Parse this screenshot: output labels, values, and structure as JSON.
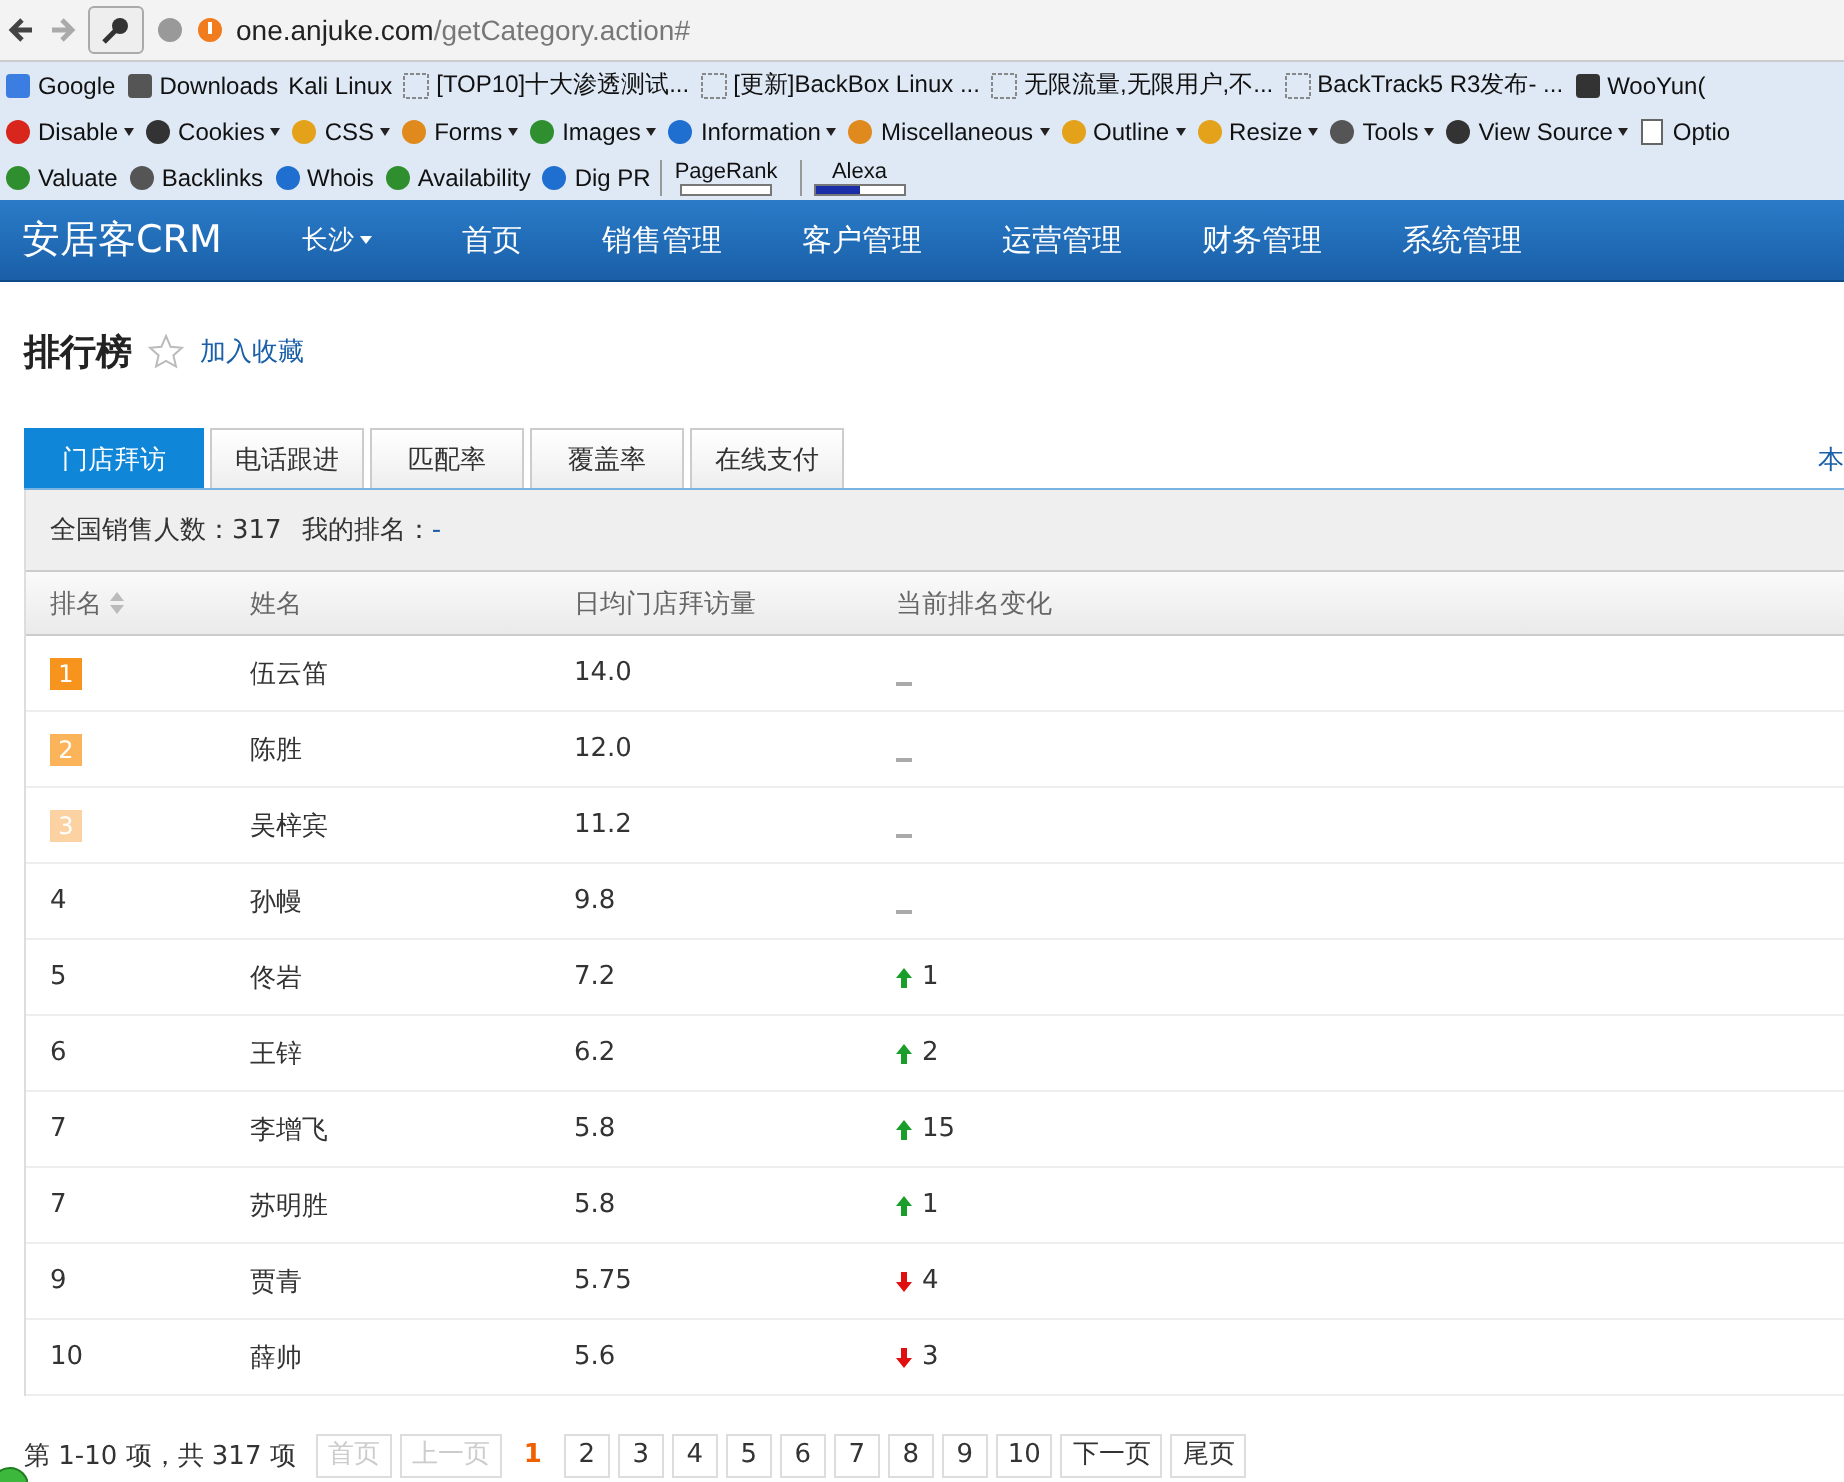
{
  "browser": {
    "url_host": "one.anjuke.com",
    "url_path": "/getCategory.action#",
    "bookmarks": [
      "Google",
      "Downloads",
      "Kali Linux",
      "[TOP10]十大渗透测试...",
      "[更新]BackBox Linux ...",
      "无限流量,无限用户,不...",
      "BackTrack5 R3发布- ...",
      "WooYun("
    ],
    "toolbar": [
      "Disable",
      "Cookies",
      "CSS",
      "Forms",
      "Images",
      "Information",
      "Miscellaneous",
      "Outline",
      "Resize",
      "Tools",
      "View Source",
      "Optio"
    ],
    "seo_tools": [
      {
        "label": "Valuate",
        "kind": "link"
      },
      {
        "label": "Backlinks",
        "kind": "link"
      },
      {
        "label": "Whois",
        "kind": "link"
      },
      {
        "label": "Availability",
        "kind": "link"
      },
      {
        "label": "Dig PR",
        "kind": "link"
      },
      {
        "label": "PageRank",
        "kind": "meter",
        "level": 0
      },
      {
        "label": "Alexa",
        "kind": "meter",
        "level": 0.5
      }
    ]
  },
  "nav": {
    "logo": "安居客CRM",
    "city": "长沙",
    "items": [
      "首页",
      "销售管理",
      "客户管理",
      "运营管理",
      "财务管理",
      "系统管理"
    ]
  },
  "page": {
    "title": "排行榜",
    "favorite": "加入收藏",
    "side_text": "本"
  },
  "tabs": [
    {
      "label": "门店拜访",
      "selected": true
    },
    {
      "label": "电话跟进",
      "selected": false
    },
    {
      "label": "匹配率",
      "selected": false
    },
    {
      "label": "覆盖率",
      "selected": false
    },
    {
      "label": "在线支付",
      "selected": false
    }
  ],
  "summary": {
    "total_label": "全国销售人数：",
    "total": "317",
    "my_rank_label": "我的排名：",
    "my_rank": "-"
  },
  "table": {
    "columns": [
      "排名",
      "姓名",
      "日均门店拜访量",
      "当前排名变化"
    ],
    "rows": [
      {
        "rank": "1",
        "color": "#f7941d",
        "name": "伍云笛",
        "value": "14.0",
        "change": {
          "kind": "none"
        }
      },
      {
        "rank": "2",
        "color": "#fbb45a",
        "name": "陈胜",
        "value": "12.0",
        "change": {
          "kind": "none"
        }
      },
      {
        "rank": "3",
        "color": "#fdd2a2",
        "name": "吴梓宾",
        "value": "11.2",
        "change": {
          "kind": "none"
        }
      },
      {
        "rank": "4",
        "name": "孙幔",
        "value": "9.8",
        "change": {
          "kind": "none"
        }
      },
      {
        "rank": "5",
        "name": "佟岩",
        "value": "7.2",
        "change": {
          "kind": "up",
          "text": "1"
        }
      },
      {
        "rank": "6",
        "name": "王锌",
        "value": "6.2",
        "change": {
          "kind": "up",
          "text": "2"
        }
      },
      {
        "rank": "7",
        "name": "李增飞",
        "value": "5.8",
        "change": {
          "kind": "up",
          "text": "15"
        }
      },
      {
        "rank": "7",
        "name": "苏明胜",
        "value": "5.8",
        "change": {
          "kind": "up",
          "text": "1"
        }
      },
      {
        "rank": "9",
        "name": "贾青",
        "value": "5.75",
        "change": {
          "kind": "down",
          "text": "4"
        }
      },
      {
        "rank": "10",
        "name": "薛帅",
        "value": "5.6",
        "change": {
          "kind": "down",
          "text": "3"
        }
      }
    ]
  },
  "pagination": {
    "summary": "第 1-10 项，共 317 项",
    "buttons": [
      {
        "label": "首页",
        "disabled": true,
        "selected": false
      },
      {
        "label": "上一页",
        "disabled": true,
        "selected": false
      },
      {
        "label": "1",
        "disabled": false,
        "selected": true
      },
      {
        "label": "2",
        "disabled": false,
        "selected": false
      },
      {
        "label": "3",
        "disabled": false,
        "selected": false
      },
      {
        "label": "4",
        "disabled": false,
        "selected": false
      },
      {
        "label": "5",
        "disabled": false,
        "selected": false
      },
      {
        "label": "6",
        "disabled": false,
        "selected": false
      },
      {
        "label": "7",
        "disabled": false,
        "selected": false
      },
      {
        "label": "8",
        "disabled": false,
        "selected": false
      },
      {
        "label": "9",
        "disabled": false,
        "selected": false
      },
      {
        "label": "10",
        "disabled": false,
        "selected": false
      },
      {
        "label": "下一页",
        "disabled": false,
        "selected": false
      },
      {
        "label": "尾页",
        "disabled": false,
        "selected": false
      }
    ]
  }
}
